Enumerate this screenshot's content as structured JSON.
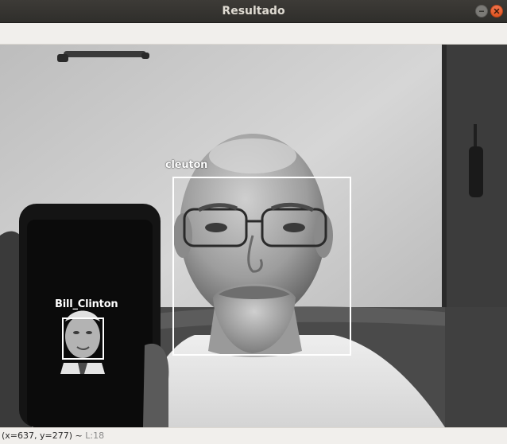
{
  "window": {
    "title": "Resultado"
  },
  "detections": [
    {
      "label": "cleuton"
    },
    {
      "label": "Bill_Clinton"
    }
  ],
  "status": {
    "coordinates": "(x=637, y=277)",
    "separator": "~",
    "value": "L:18"
  },
  "colors": {
    "titlebar": "#3b3a36",
    "close_button": "#e95420",
    "box_and_label": "#ffffff"
  },
  "icons": {
    "minimize": "minimize-icon",
    "close": "close-icon"
  }
}
